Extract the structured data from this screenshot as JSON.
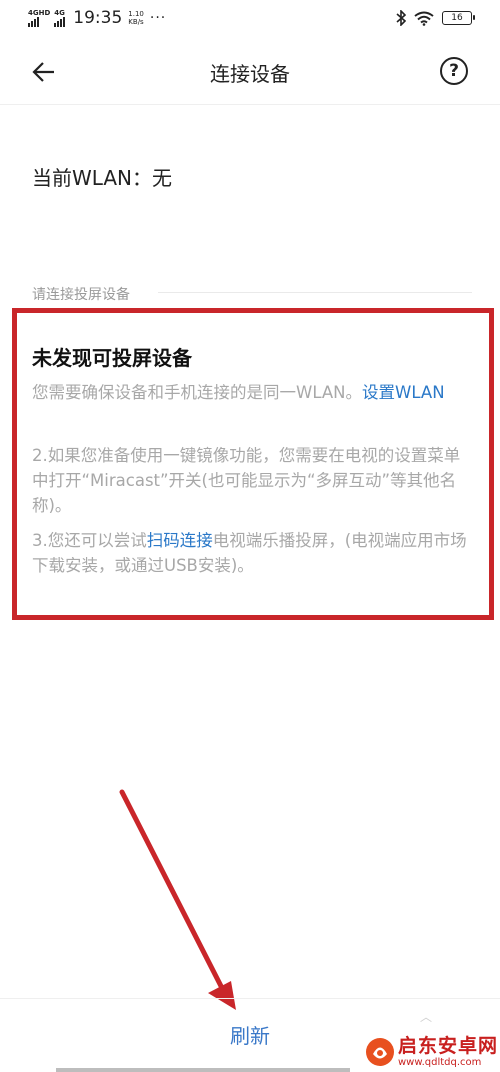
{
  "status_bar": {
    "sim1_label": "4GHD",
    "sim2_label": "4G",
    "time": "19:35",
    "speed_value": "1.10",
    "speed_unit": "KB/s",
    "more": "···",
    "battery": "16"
  },
  "nav": {
    "title": "连接设备",
    "help": "?"
  },
  "wlan": {
    "text": "当前WLAN：无"
  },
  "section": {
    "label": "请连接投屏设备"
  },
  "notice": {
    "title": "未发现可投屏设备",
    "p1_text": "您需要确保设备和手机连接的是同一WLAN。",
    "p1_link": "设置WLAN",
    "p2_text": "2.如果您准备使用一键镜像功能，您需要在电视的设置菜单中打开“Miracast”开关(也可能显示为“多屏互动”等其他名称)。",
    "p3_prefix": "3.您还可以尝试",
    "p3_link": "扫码连接",
    "p3_suffix": "电视端乐播投屏，(电视端应用市场下载安装，或通过USB安装)。"
  },
  "bottom": {
    "refresh": "刷新",
    "chevron": "︿"
  },
  "watermark": {
    "name": "启东安卓网",
    "url": "www.qdltdq.com"
  },
  "colors": {
    "highlight": "#c9262a",
    "link": "#2a78c8",
    "refresh": "#3a78c8"
  }
}
